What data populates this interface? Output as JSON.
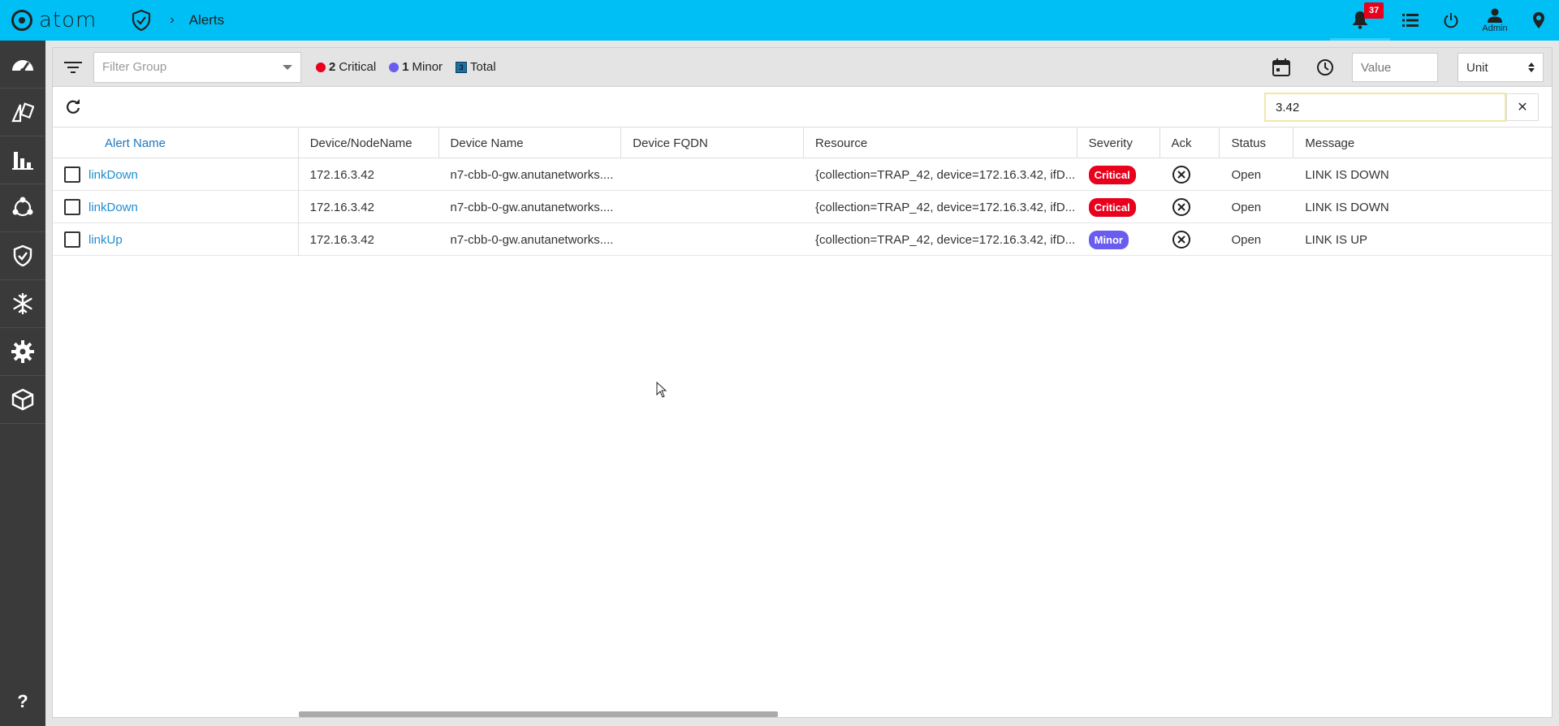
{
  "app": {
    "brand": "atom",
    "breadcrumb_title": "Alerts"
  },
  "topbar": {
    "notification_count": "37",
    "user_label": "Admin"
  },
  "toolbar": {
    "filter_group_placeholder": "Filter Group",
    "critical_count": "2",
    "critical_label": "Critical",
    "minor_count": "1",
    "minor_label": "Minor",
    "total_count": "3",
    "total_label": "Total",
    "value_placeholder": "Value",
    "unit_label": "Unit"
  },
  "search": {
    "value": "3.42"
  },
  "colors": {
    "topbar": "#00bff5",
    "critical": "#e8001c",
    "minor": "#6a5cf0",
    "link": "#1f8ed0",
    "sidebar": "#3a3a3a"
  },
  "table": {
    "headers": [
      "Alert Name",
      "Device/NodeName",
      "Device Name",
      "Device FQDN",
      "Resource",
      "Severity",
      "Ack",
      "Status",
      "Message"
    ],
    "rows": [
      {
        "alert_name": "linkDown",
        "node": "172.16.3.42",
        "device_name": "n7-cbb-0-gw.anutanetworks....",
        "fqdn": "",
        "resource": "{collection=TRAP_42, device=172.16.3.42, ifD...",
        "severity": "Critical",
        "status": "Open",
        "message": "LINK IS DOWN"
      },
      {
        "alert_name": "linkDown",
        "node": "172.16.3.42",
        "device_name": "n7-cbb-0-gw.anutanetworks....",
        "fqdn": "",
        "resource": "{collection=TRAP_42, device=172.16.3.42, ifD...",
        "severity": "Critical",
        "status": "Open",
        "message": "LINK IS DOWN"
      },
      {
        "alert_name": "linkUp",
        "node": "172.16.3.42",
        "device_name": "n7-cbb-0-gw.anutanetworks....",
        "fqdn": "",
        "resource": "{collection=TRAP_42, device=172.16.3.42, ifD...",
        "severity": "Minor",
        "status": "Open",
        "message": "LINK IS UP"
      }
    ]
  },
  "sidebar": {
    "help": "?"
  }
}
